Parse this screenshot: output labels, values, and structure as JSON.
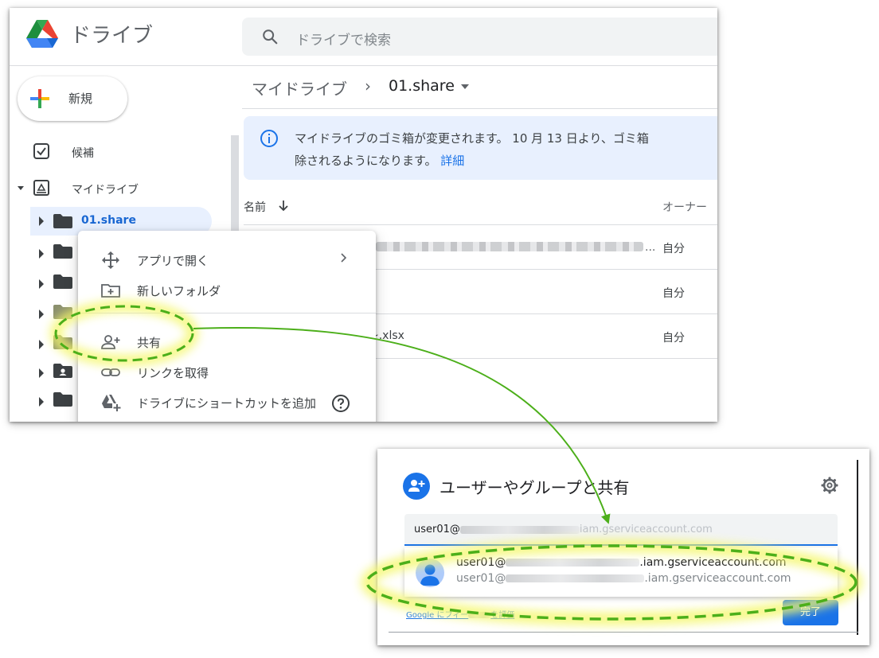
{
  "drive": {
    "brand": "ドライブ",
    "search_placeholder": "ドライブで検索",
    "new_label": "新規",
    "nav": {
      "suggested": "候補",
      "my_drive": "マイドライブ",
      "selected_folder": "01.share"
    },
    "breadcrumb": {
      "root": "マイドライブ",
      "separator": "›",
      "current": "01.share"
    },
    "notice": {
      "line1": "マイドライブのゴミ箱が変更されます。 10 月 13 日より、ゴミ箱",
      "line2": "除されるようになります。",
      "link": "詳細"
    },
    "list": {
      "col_name": "名前",
      "col_owner": "オーナー",
      "rows": [
        {
          "owner": "自分",
          "name_suffix": "..."
        },
        {
          "owner": "自分",
          "name_suffix": ""
        },
        {
          "owner": "自分",
          "name_suffix": "~.xlsx"
        }
      ]
    },
    "context_menu": {
      "open_with": "アプリで開く",
      "new_folder": "新しいフォルダ",
      "share": "共有",
      "get_link": "リンクを取得",
      "add_shortcut": "ドライブにショートカットを追加"
    }
  },
  "share_dialog": {
    "title": "ユーザーやグループと共有",
    "email_value_prefix": "user01@",
    "email_value_suffix": "iam.gserviceaccount.com",
    "suggestion_line1_prefix": "user01@",
    "suggestion_line1_suffix": ".iam.gserviceaccount.com",
    "suggestion_line2_prefix": "user01@",
    "suggestion_line2_suffix": ".iam.gserviceaccount.com",
    "google_link_prefix": "Google にフィー",
    "google_link_suffix": "を評価",
    "done_label": "完了"
  },
  "colors": {
    "accent_blue": "#1a73e8",
    "selection_bg": "#e8f0fe",
    "annotation_green": "#4caf1a",
    "annotation_glow": "#f4f76a"
  }
}
